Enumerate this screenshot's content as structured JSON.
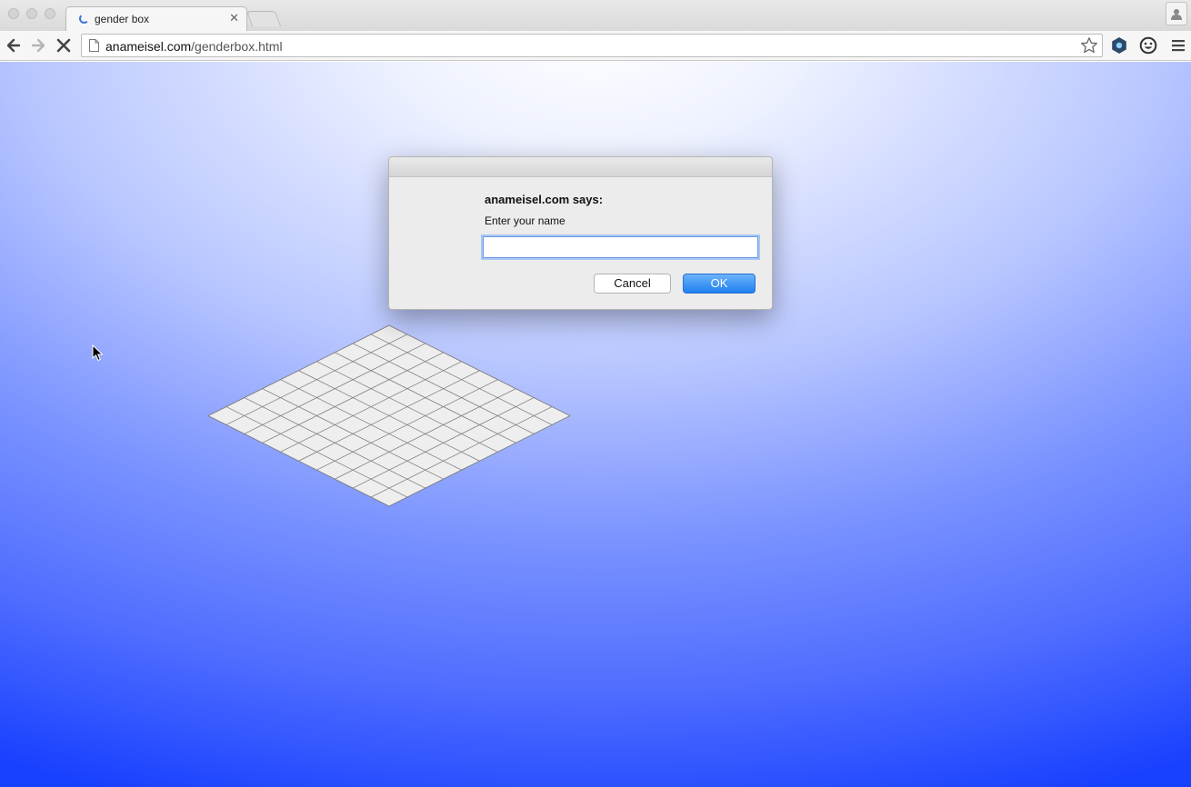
{
  "browser": {
    "tab": {
      "title": "gender box"
    },
    "address": {
      "domain": "anameisel.com",
      "path": "/genderbox.html"
    }
  },
  "dialog": {
    "heading": "anameisel.com says:",
    "message": "Enter your name",
    "input_value": "",
    "cancel_label": "Cancel",
    "ok_label": "OK"
  },
  "colors": {
    "ok_button": "#1e7ff0",
    "page_gradient_top": "#ffffff",
    "page_gradient_bottom": "#1840ff",
    "grid_fill": "#eeeeee",
    "grid_stroke": "#777777"
  },
  "icons": [
    "back-icon",
    "forward-icon",
    "stop-icon",
    "page-icon",
    "star-icon",
    "extension-icon",
    "smiley-icon",
    "menu-icon",
    "profile-icon",
    "loading-spinner-icon",
    "close-icon"
  ]
}
